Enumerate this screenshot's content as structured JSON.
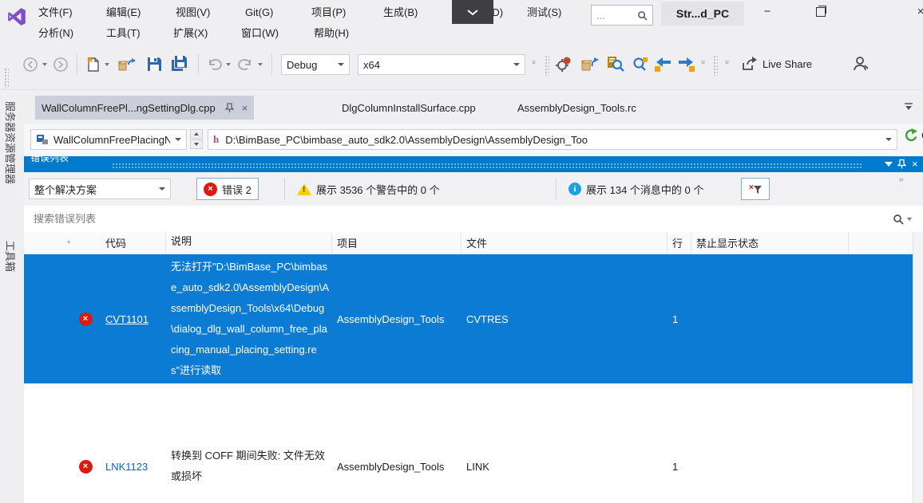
{
  "colors": {
    "accent_blue": "#007ACC",
    "selection_blue": "#0B7BD3",
    "error_red": "#DC1A0F",
    "warning_yellow": "#FFCC00",
    "info_blue": "#1BA1E2",
    "go_green": "#3FA23F",
    "logo_purple": "#7F4EC9",
    "chrome_gray": "#EFEFF2"
  },
  "window": {
    "title_chip": "Str...d_PC",
    "quick_search_text": "...",
    "menus_row1": [
      "文件(F)",
      "编辑(E)",
      "视图(V)",
      "Git(G)",
      "项目(P)",
      "生成(B)",
      "调试(D)",
      "测试(S)"
    ],
    "menus_row2": [
      "分析(N)",
      "工具(T)",
      "扩展(X)",
      "窗口(W)",
      "帮助(H)"
    ]
  },
  "toolbar": {
    "config": "Debug",
    "platform": "x64",
    "live_share": "Live Share"
  },
  "editor_tabs": [
    {
      "label": "WallColumnFreePl...ngSettingDlg.cpp",
      "active": true
    },
    {
      "label": "DlgColumnInstallSurface.cpp",
      "active": false
    },
    {
      "label": "AssemblyDesign_Tools.rc",
      "active": false
    }
  ],
  "side_tabs": [
    "服务器资源管理器",
    "工具箱"
  ],
  "navbar": {
    "scope": "WallColumnFreePlacingN",
    "file_type": "h",
    "path": "D:\\BimBase_PC\\bimbase_auto_sdk2.0\\AssemblyDesign\\AssemblyDesign_Too",
    "go": "Go"
  },
  "error_list": {
    "title": "错误列表",
    "scope": "整个解决方案",
    "errors_button": "错误 2",
    "warnings_button": "展示 3536 个警告中的 0 个",
    "messages_button": "展示 134 个消息中的 0 个",
    "search_placeholder": "搜索错误列表",
    "columns": {
      "code": "代码",
      "description": "说明",
      "project": "项目",
      "file": "文件",
      "line": "行",
      "suppression": "禁止显示状态"
    },
    "rows": [
      {
        "severity": "error",
        "code": "CVT1101",
        "description": "无法打开\"D:\\BimBase_PC\\bimbase_auto_sdk2.0\\AssemblyDesign\\AssemblyDesign_Tools\\x64\\Debug\\dialog_dlg_wall_column_free_placing_manual_placing_setting.res\"进行读取",
        "project": "AssemblyDesign_Tools",
        "file": "CVTRES",
        "line": "1",
        "selected": true
      },
      {
        "severity": "error",
        "code": "LNK1123",
        "description": "转换到 COFF 期间失败: 文件无效或损坏",
        "project": "AssemblyDesign_Tools",
        "file": "LINK",
        "line": "1",
        "selected": false
      }
    ]
  },
  "glyphs": {
    "close": "×",
    "minimize": "−",
    "error": "×",
    "info": "i",
    "warning": "!",
    "overflow": "››",
    "sort": "ⁿ",
    "pin": "-¤"
  }
}
